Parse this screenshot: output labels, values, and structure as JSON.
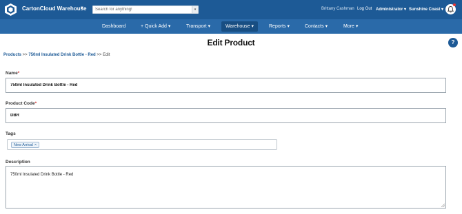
{
  "header": {
    "app_name": "CartonCloud Warehouse",
    "search_placeholder": "Search for anything!",
    "user_name": "Brittany Cashman",
    "logout_label": "Log Out",
    "role_label": "Administrator ▾",
    "region_label": "Sunshine Coast ▾",
    "icons": [
      "logo-icon",
      "chevron-down-icon",
      "search-dropdown-icon",
      "bell-icon"
    ],
    "notification_dot_color": "#e53935"
  },
  "nav": {
    "items": [
      {
        "label": "Dashboard"
      },
      {
        "label": "+ Quick Add ▾"
      },
      {
        "label": "Transport ▾"
      },
      {
        "label": "Warehouse ▾"
      },
      {
        "label": "Reports ▾"
      },
      {
        "label": "Contacts ▾"
      },
      {
        "label": "More ▾"
      }
    ],
    "active": "Warehouse ▾"
  },
  "page": {
    "title": "Edit Product",
    "help_label": "?"
  },
  "breadcrumb": {
    "root": "Products",
    "sep1": " >> ",
    "product": "750ml Insulated Drink Bottle - Red",
    "sep2": " >> ",
    "current": "Edit"
  },
  "form": {
    "name_label": "Name",
    "name_value": "750ml Insulated Drink Bottle - Red",
    "code_label": "Product Code",
    "code_value": "DBR",
    "tags_label": "Tags",
    "tags": [
      {
        "label": "New Arrival",
        "remove": "×"
      }
    ],
    "description_label": "Description",
    "description_value": "750ml Insulated Drink Bottle - Red",
    "required_marker": "*"
  },
  "colors": {
    "header_bg": "#1d5a96",
    "nav_bg": "#2a6aa9",
    "nav_active_bg": "#184e82",
    "link": "#1d5a96",
    "required": "#d32f2f"
  }
}
